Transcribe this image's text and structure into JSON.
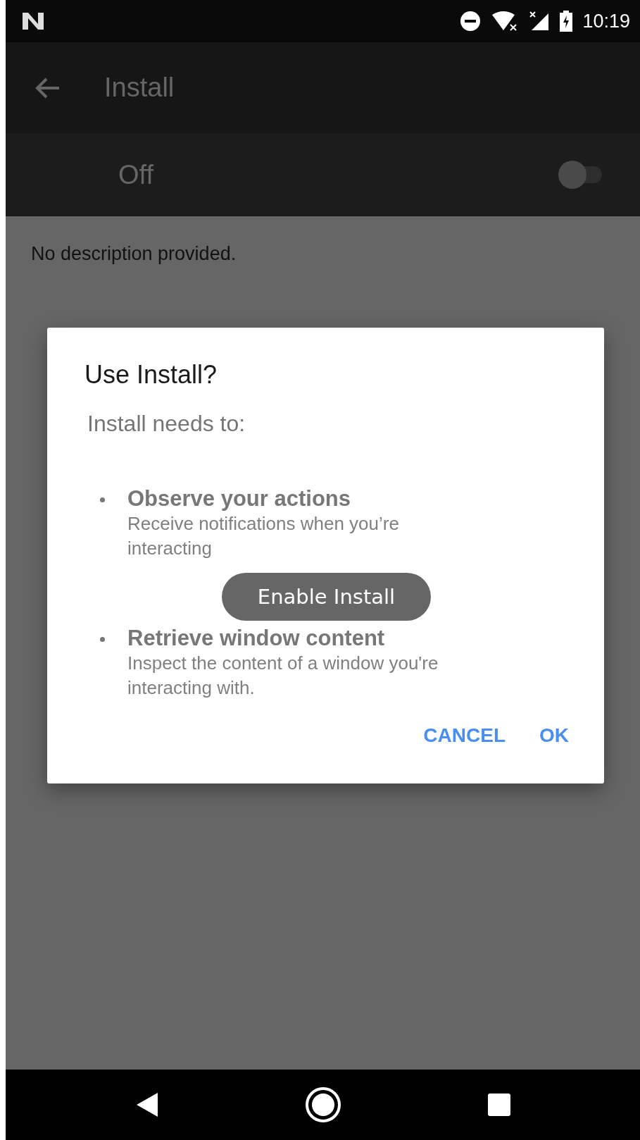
{
  "status_bar": {
    "time": "10:19"
  },
  "toolbar": {
    "title": "Install"
  },
  "master_switch": {
    "label": "Off",
    "on": false
  },
  "description": "No description provided.",
  "dialog": {
    "title": "Use Install?",
    "intro": "Install needs to:",
    "permissions": [
      {
        "title": "Observe your actions",
        "detail": "Receive notifications when you’re interacting"
      },
      {
        "title": "Retrieve window content",
        "detail": "Inspect the content of a window you're interacting with."
      }
    ],
    "buttons": [
      "CANCEL",
      "OK"
    ]
  },
  "toast": "Enable Install"
}
